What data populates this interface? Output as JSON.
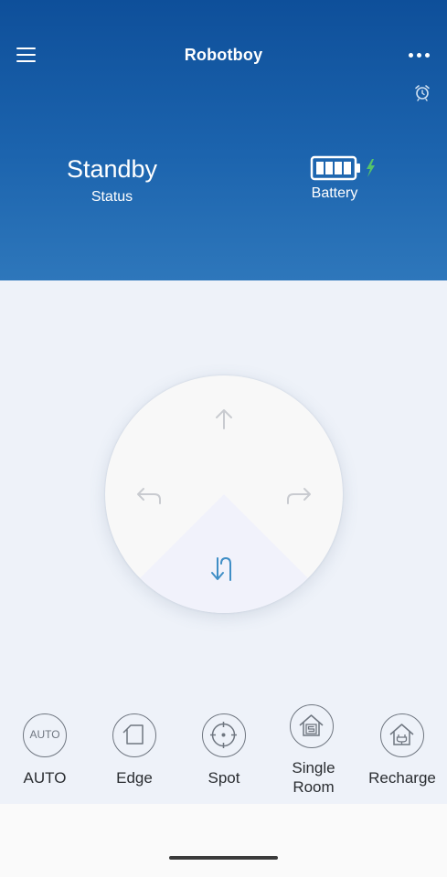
{
  "app": {
    "title": "Robotboy"
  },
  "status": {
    "value": "Standby",
    "label": "Status"
  },
  "battery": {
    "label": "Battery",
    "charging": true,
    "level_segments": 4,
    "charging_color": "#55c26a"
  },
  "colors": {
    "header_top": "#0e4f9a",
    "header_bottom": "#2e77bb",
    "accent": "#3f8ec6",
    "main_bg": "#eef2f9"
  },
  "icons": {
    "menu": "hamburger-menu-icon",
    "more": "more-dots-icon",
    "alarm": "alarm-clock-icon",
    "battery": "battery-icon",
    "bolt": "lightning-bolt-icon",
    "forward": "arrow-up-icon",
    "left": "turn-left-icon",
    "right": "turn-right-icon",
    "back": "u-turn-icon"
  },
  "modes": [
    {
      "id": "auto",
      "label": "AUTO",
      "icon_text": "AUTO"
    },
    {
      "id": "edge",
      "label": "Edge"
    },
    {
      "id": "spot",
      "label": "Spot"
    },
    {
      "id": "single-room",
      "label": "Single Room",
      "label_line1": "Single",
      "label_line2": "Room"
    },
    {
      "id": "recharge",
      "label": "Recharge"
    }
  ]
}
